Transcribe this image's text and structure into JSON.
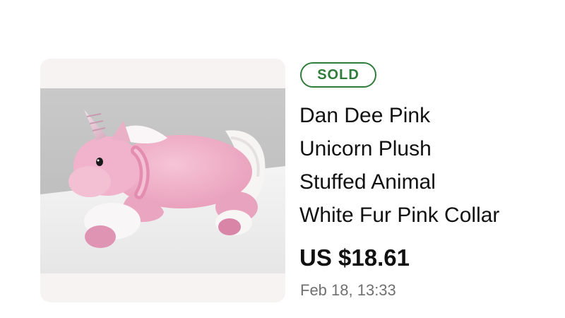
{
  "listing": {
    "status_badge": "SOLD",
    "title_lines": [
      "Dan Dee Pink",
      "Unicorn Plush",
      "Stuffed Animal",
      "White Fur Pink Collar"
    ],
    "price": "US $18.61",
    "sold_date": "Feb 18, 13:33",
    "image_subject": "pink unicorn plush"
  },
  "colors": {
    "badge_green": "#2f7d3a",
    "title_text": "#111111",
    "date_text": "#707070",
    "thumb_bg": "#f7f3f3"
  }
}
